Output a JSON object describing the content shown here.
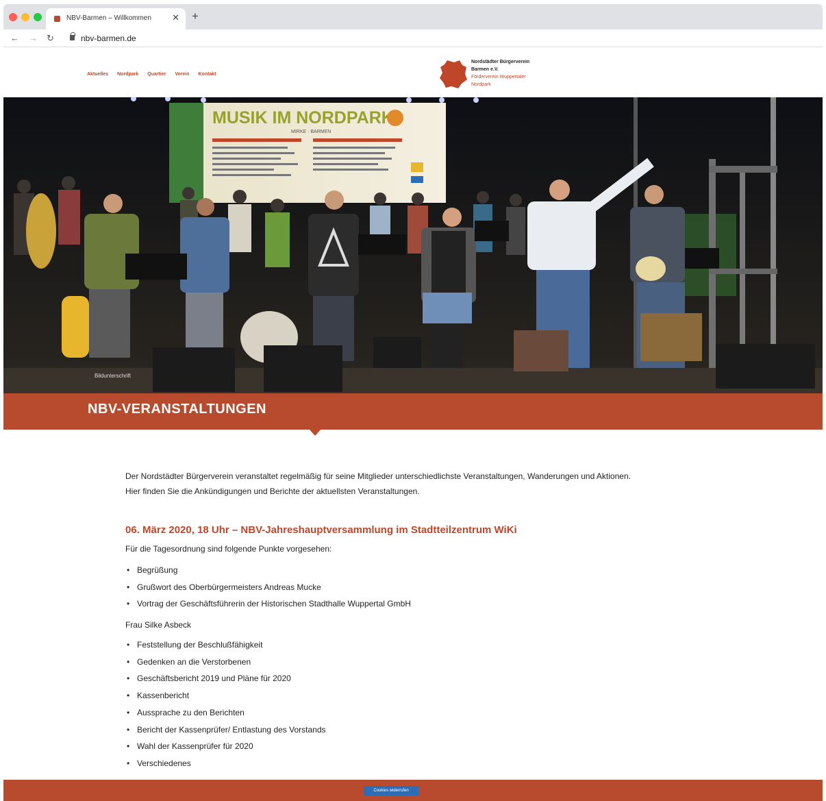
{
  "browser": {
    "tab_title": "NBV-Barmen – Willkommen",
    "url": "nbv-barmen.de"
  },
  "site": {
    "nav": [
      "Aktuelles",
      "Nordpark",
      "Quartier",
      "Verein",
      "Kontakt"
    ],
    "logo": {
      "line1": "Nordstädter Bürgerverein",
      "line2": "Barmen e.V.",
      "line3": "Förderverein Wuppertaler",
      "line4": "Nordpark"
    }
  },
  "hero": {
    "banner_title": "MUSIK IM NORDPARK",
    "banner_subtitle": "MIRKE · BARMEN",
    "caption": "Bildunterschrift"
  },
  "section": {
    "title": "NBV-VERANSTALTUNGEN"
  },
  "content": {
    "intro": "Der Nordstädter Bürgerverein veranstaltet regelmäßig für seine Mitglieder unterschiedlichste Veranstaltungen, Wanderungen und Aktionen. Hier finden Sie die Ankündigungen und Berichte der aktuellsten Veranstaltungen.",
    "event_title": "06. März 2020, 18 Uhr – NBV-Jahreshauptversammlung im Stadtteilzentrum WiKi",
    "agenda_lead": "Für die Tagesordnung sind folgende Punkte vorgesehen:",
    "agenda_part1": [
      "Begrüßung",
      "Grußwort des Oberbürgermeisters Andreas Mucke",
      "Vortrag der Geschäftsführerin der Historischen Stadthalle Wuppertal GmbH"
    ],
    "speaker": "Frau  Silke Asbeck",
    "agenda_part2": [
      "Feststellung der Beschlußfähigkeit",
      "Gedenken an die Verstorbenen",
      "Geschäftsbericht 2019 und Pläne für 2020",
      "Kassenbericht",
      "Aussprache zu den Berichten",
      "Bericht der Kassenprüfer/ Entlastung des Vorstands",
      "Wahl der Kassenprüfer für 2020",
      "Verschiedenes"
    ]
  },
  "cookie": {
    "button_label": "Cookies widerrufen"
  },
  "colors": {
    "accent": "#b84a2e",
    "heading": "#c0462a",
    "cookie_button": "#2d6db5"
  }
}
